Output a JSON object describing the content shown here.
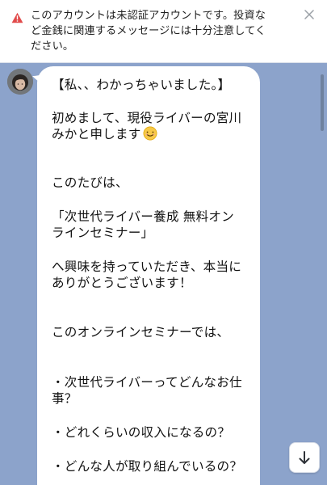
{
  "warning_banner": {
    "lines": [
      "このアカウントは未認証アカウントです。投資な",
      "ど金銭に関連するメッセージには十分注意してく",
      "ださい。"
    ],
    "accent_color": "#e14b4b"
  },
  "message": {
    "lines": [
      "【私、、わかっちゃいました。】",
      "初めまして、現役ライバーの宮川",
      "みかと申します",
      "このたびは、",
      "「次世代ライバー養成 無料オン",
      "ラインセミナー」",
      "へ興味を持っていただき、本当に",
      "ありがとうございます！",
      "このオンラインセミナーでは、",
      "・次世代ライバーってどんなお仕",
      "事？",
      "・どれくらいの収入になるの？",
      "・どんな人が取り組んでいるの？"
    ],
    "emoji_name": "smiling-face-emoji"
  },
  "colors": {
    "chat_background": "#8ca3cb",
    "bubble": "#ffffff"
  }
}
